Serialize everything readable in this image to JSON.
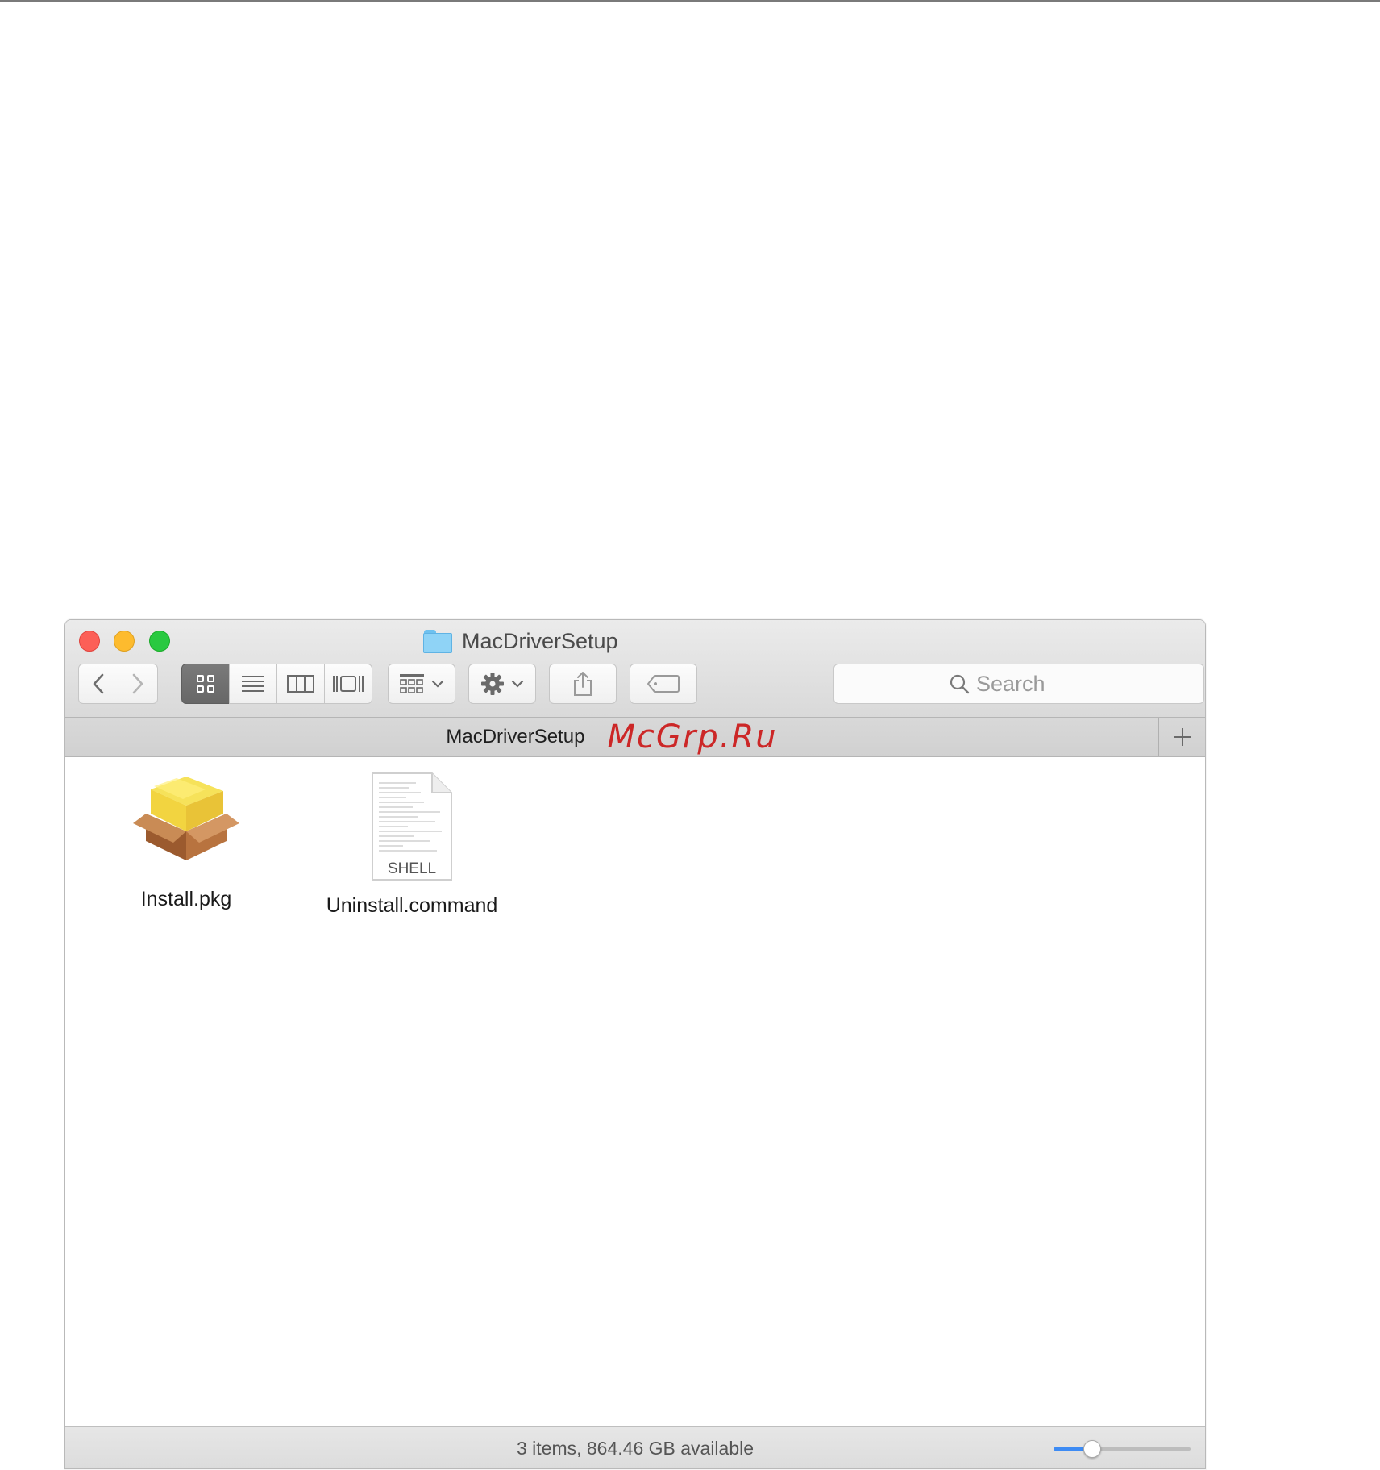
{
  "window": {
    "title": "MacDriverSetup",
    "tab_title": "MacDriverSetup",
    "watermark": "McGrp.Ru"
  },
  "toolbar": {
    "back_icon": "chevron-left-icon",
    "forward_icon": "chevron-right-icon",
    "view_modes": [
      "icon-view",
      "list-view",
      "column-view",
      "cover-flow-view"
    ],
    "active_view": "icon-view",
    "arrange_icon": "arrange-grid-icon",
    "action_icon": "gear-icon",
    "share_icon": "share-icon",
    "tag_icon": "tag-icon",
    "search_placeholder": "Search"
  },
  "files": [
    {
      "name": "Install.pkg",
      "icon": "package-icon"
    },
    {
      "name": "Uninstall.command",
      "icon": "shell-script-icon",
      "icon_text": "SHELL"
    }
  ],
  "status": {
    "text": "3 items, 864.46 GB available",
    "icon_size_fraction": 0.25
  },
  "colors": {
    "close": "#fc5f57",
    "minimize": "#fdbb2e",
    "zoom": "#29c940",
    "slider_accent": "#3d8bf4",
    "watermark": "#cc2727"
  }
}
